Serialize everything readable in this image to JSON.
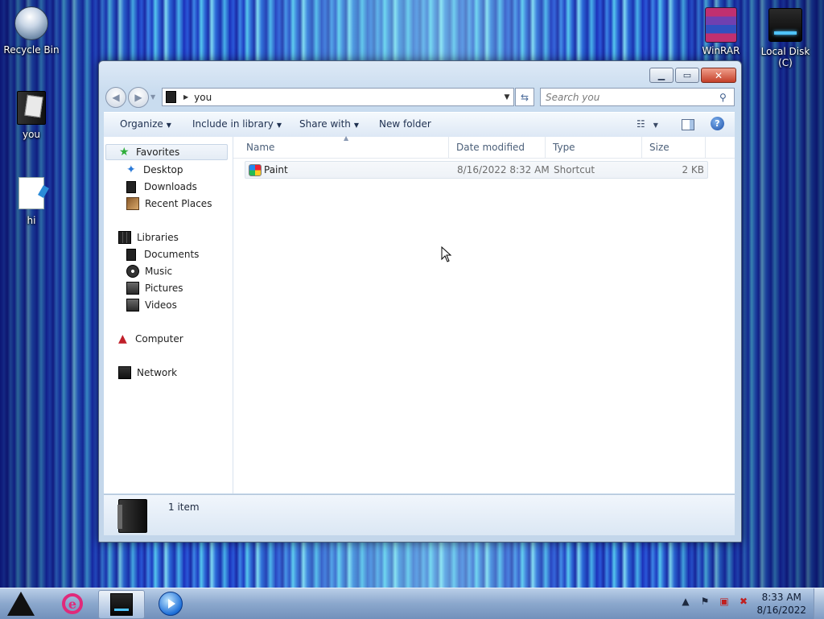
{
  "desktop": {
    "icons": [
      {
        "label": "Recycle Bin",
        "icon": "recycle-bin-icon"
      },
      {
        "label": "you",
        "icon": "user-folder-icon"
      },
      {
        "label": "hi",
        "icon": "document-icon"
      },
      {
        "label": "WinRAR",
        "icon": "winrar-icon"
      },
      {
        "label": "Local Disk (C)",
        "icon": "hard-drive-icon"
      }
    ]
  },
  "window": {
    "caption": {
      "minimize": "minimize-icon",
      "maximize": "maximize-icon",
      "close": "close-icon"
    },
    "address": {
      "path": "you"
    },
    "search": {
      "placeholder": "Search you"
    },
    "toolbar": {
      "organize": "Organize",
      "include_in_library": "Include in library",
      "share_with": "Share with",
      "new_folder": "New folder"
    },
    "nav": {
      "favorites": "Favorites",
      "desktop": "Desktop",
      "downloads": "Downloads",
      "recent_places": "Recent Places",
      "libraries": "Libraries",
      "documents": "Documents",
      "music": "Music",
      "pictures": "Pictures",
      "videos": "Videos",
      "computer": "Computer",
      "network": "Network"
    },
    "columns": {
      "name": "Name",
      "date_modified": "Date modified",
      "type": "Type",
      "size": "Size"
    },
    "files": [
      {
        "name": "Paint",
        "date_modified": "8/16/2022 8:32 AM",
        "type": "Shortcut",
        "size": "2 KB"
      }
    ],
    "details": {
      "count": "1 item"
    }
  },
  "taskbar": {
    "clock": {
      "time": "8:33 AM",
      "date": "8/16/2022"
    }
  }
}
